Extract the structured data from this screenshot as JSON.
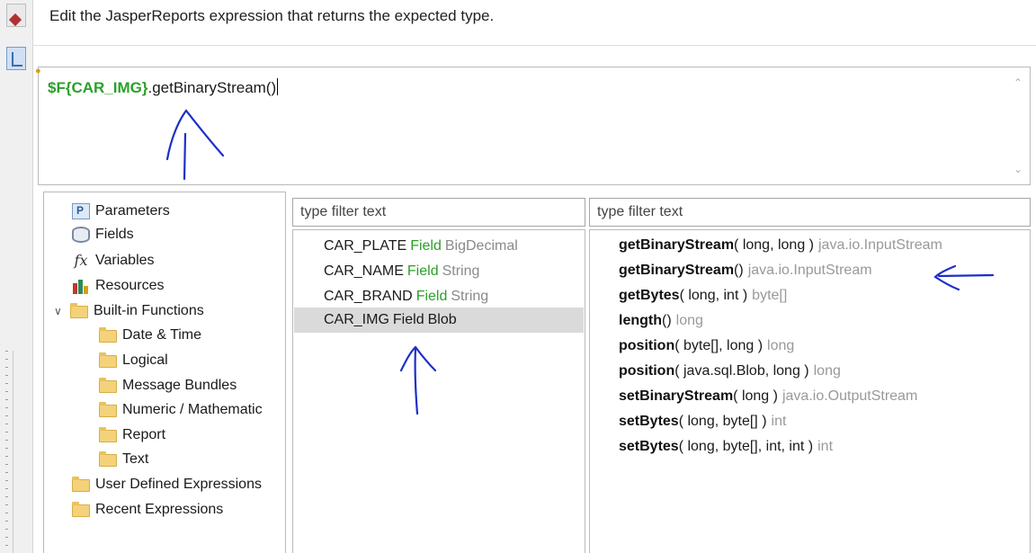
{
  "instruction": "Edit the JasperReports expression that returns the expected type.",
  "editor": {
    "expression_field": "$F{CAR_IMG}",
    "expression_call": ".getBinaryStream()"
  },
  "tree": {
    "parameters": "Parameters",
    "fields": "Fields",
    "variables": "Variables",
    "resources": "Resources",
    "builtin": "Built-in Functions",
    "date_time": "Date & Time",
    "logical": "Logical",
    "message_bundles": "Message Bundles",
    "numeric": "Numeric / Mathematic",
    "report": "Report",
    "text": "Text",
    "user_defined": "User Defined Expressions",
    "recent": "Recent Expressions"
  },
  "fields_filter": {
    "placeholder": "type filter text"
  },
  "methods_filter": {
    "placeholder": "type filter text"
  },
  "fields": [
    {
      "name": "CAR_PLATE",
      "kw": "Field",
      "type": "BigDecimal"
    },
    {
      "name": "CAR_NAME",
      "kw": "Field",
      "type": "String"
    },
    {
      "name": "CAR_BRAND",
      "kw": "Field",
      "type": "String"
    },
    {
      "name": "CAR_IMG",
      "kw": "Field",
      "type": "Blob"
    }
  ],
  "methods": [
    {
      "name": "getBinaryStream",
      "args": "( long, long )",
      "ret": "java.io.InputStream"
    },
    {
      "name": "getBinaryStream",
      "args": "()",
      "ret": "java.io.InputStream"
    },
    {
      "name": "getBytes",
      "args": "( long, int )",
      "ret": "byte[]"
    },
    {
      "name": "length",
      "args": "()",
      "ret": "long"
    },
    {
      "name": "position",
      "args": "( byte[], long )",
      "ret": "long"
    },
    {
      "name": "position",
      "args": "( java.sql.Blob, long )",
      "ret": "long"
    },
    {
      "name": "setBinaryStream",
      "args": "( long )",
      "ret": "java.io.OutputStream"
    },
    {
      "name": "setBytes",
      "args": "( long, byte[] )",
      "ret": "int"
    },
    {
      "name": "setBytes",
      "args": "( long, byte[], int, int )",
      "ret": "int"
    }
  ],
  "colors": {
    "field_keyword": "#2aa02a",
    "type_gray": "#999999",
    "annotation_ink": "#1c2fc9",
    "selection": "#dadada"
  }
}
